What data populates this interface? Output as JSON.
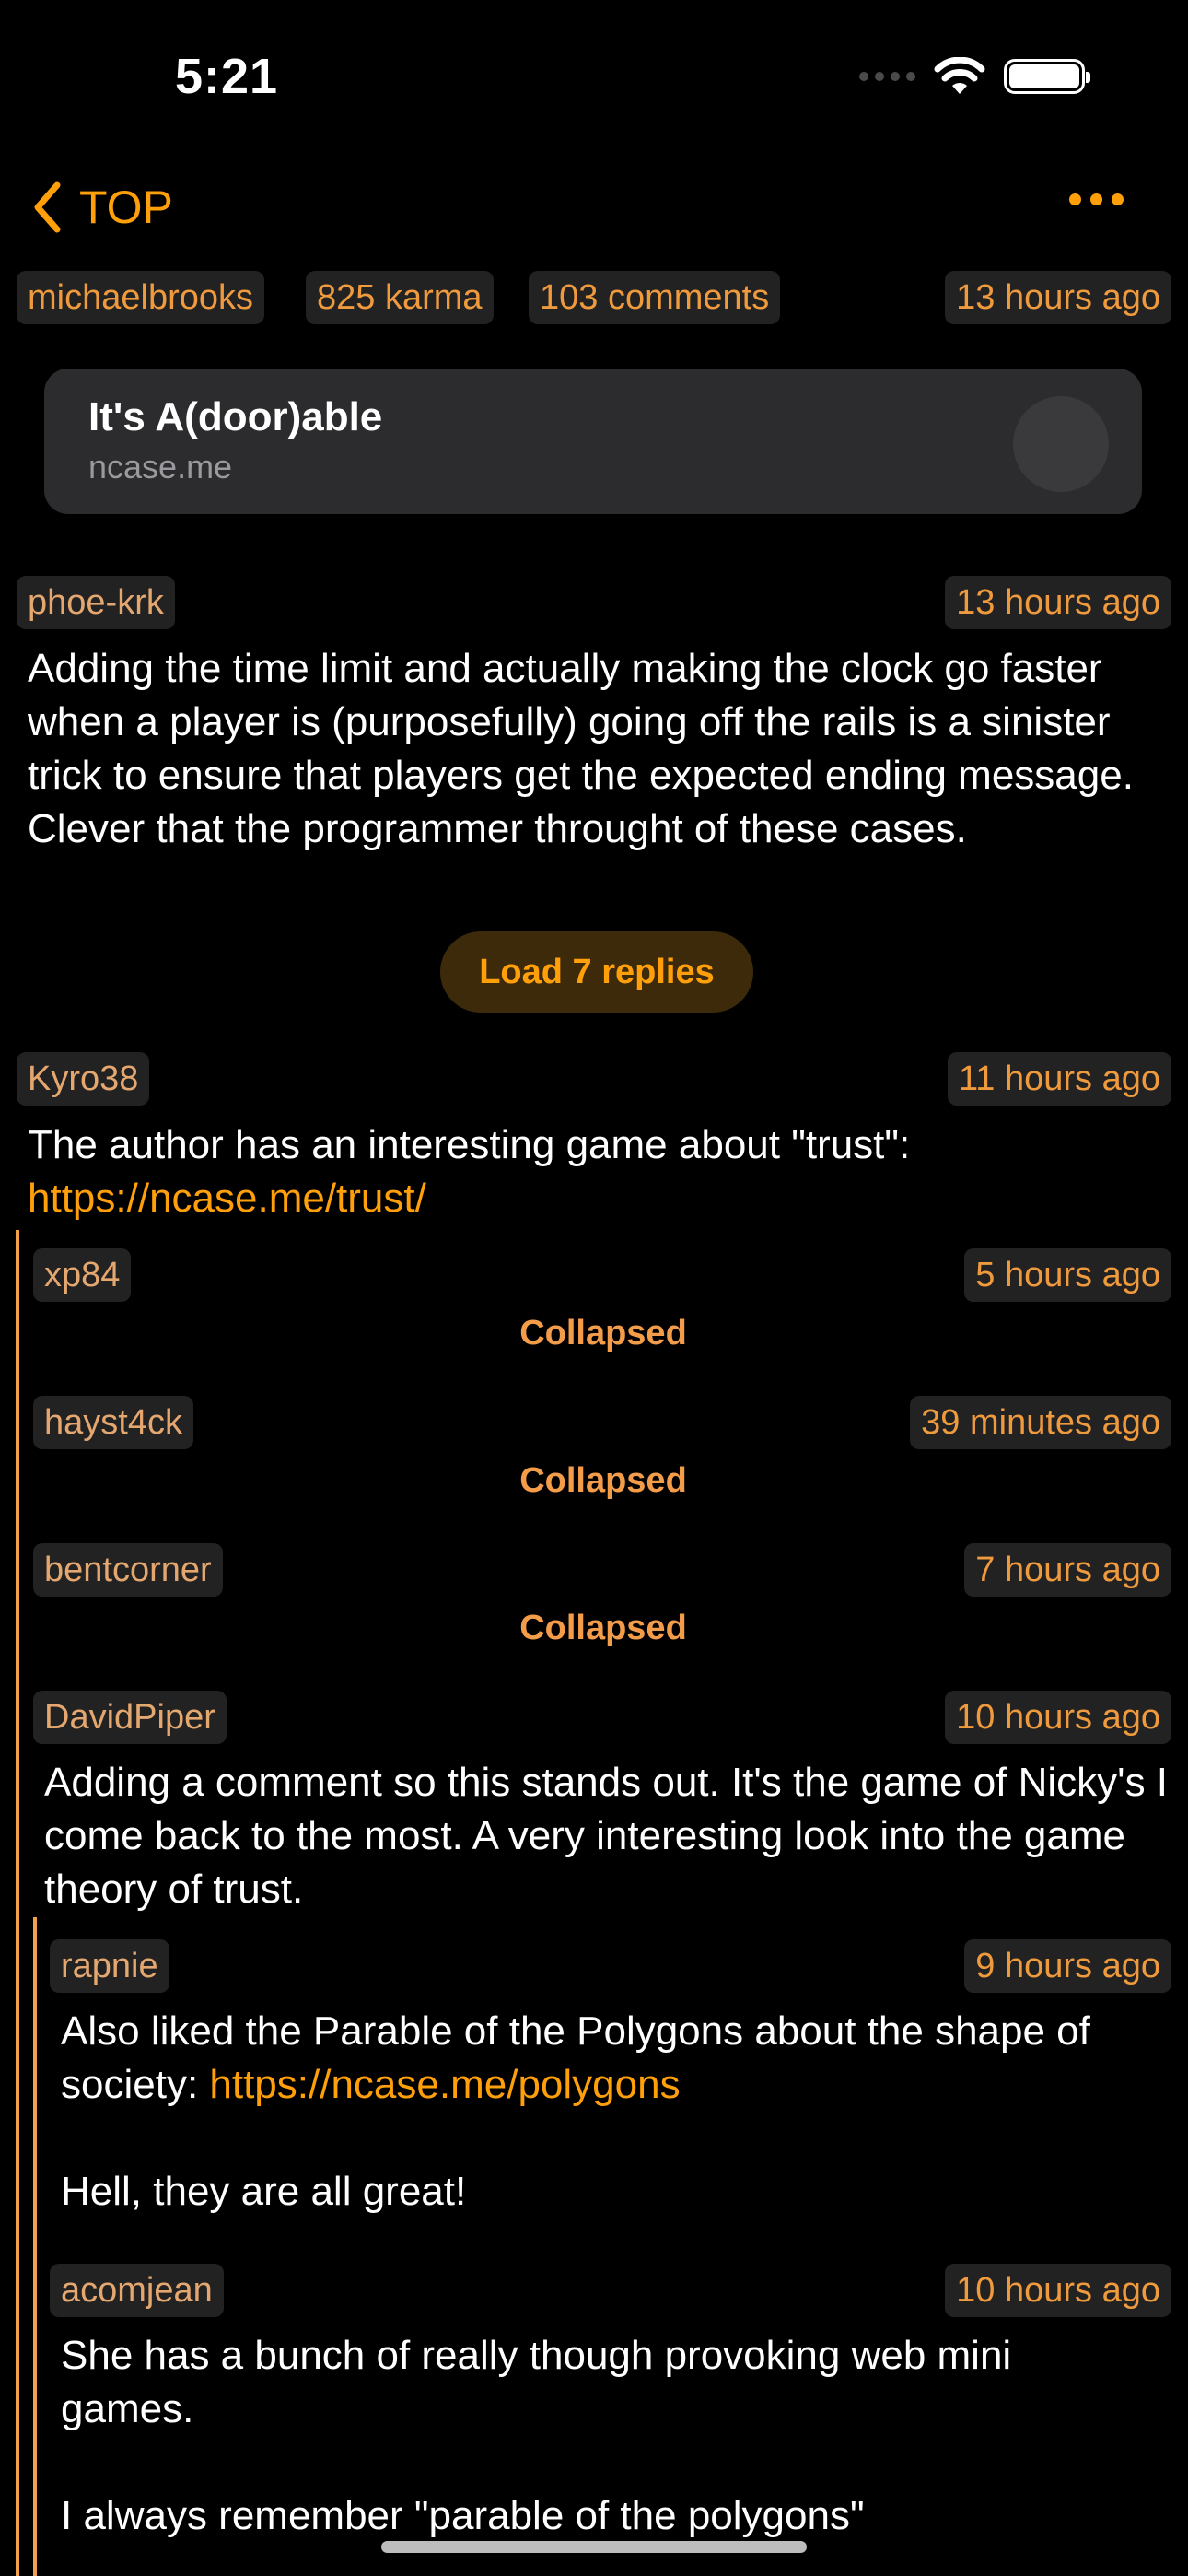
{
  "status_bar": {
    "time": "5:21"
  },
  "nav": {
    "back_label": "TOP"
  },
  "post": {
    "author": "michaelbrooks",
    "karma": "825 karma",
    "comments": "103 comments",
    "time": "13 hours ago",
    "link_title": "It's A(door)able",
    "link_domain": "ncase.me"
  },
  "comments": [
    {
      "author": "phoe-krk",
      "time": "13 hours ago",
      "text": "Adding the time limit and actually making the clock go faster when a player is (purposefully) going off the rails is a sinister trick to ensure that players get the expected ending message. Clever that the programmer throught of these cases.",
      "load_replies": "Load 7 replies"
    },
    {
      "author": "Kyro38",
      "time": "11 hours ago",
      "text_prefix": "The author has an interesting game about \"trust\": ",
      "link": "https://ncase.me/trust/"
    },
    {
      "author": "xp84",
      "time": "5 hours ago",
      "state": "Collapsed"
    },
    {
      "author": "hayst4ck",
      "time": "39 minutes ago",
      "state": "Collapsed"
    },
    {
      "author": "bentcorner",
      "time": "7 hours ago",
      "state": "Collapsed"
    },
    {
      "author": "DavidPiper",
      "time": "10 hours ago",
      "text": "Adding a comment so this stands out. It's the game of Nicky's I come back to the most. A very interesting look into the game theory of trust."
    },
    {
      "author": "rapnie",
      "time": "9 hours ago",
      "text_prefix": "Also liked the Parable of the Polygons about the shape of society: ",
      "link": "https://ncase.me/polygons",
      "text_suffix": "Hell, they are all great!"
    },
    {
      "author": "acomjean",
      "time": "10 hours ago",
      "text_line1": "She has a bunch of really though provoking web mini games.",
      "text_line2": "I always remember \"parable of the polygons\""
    }
  ]
}
